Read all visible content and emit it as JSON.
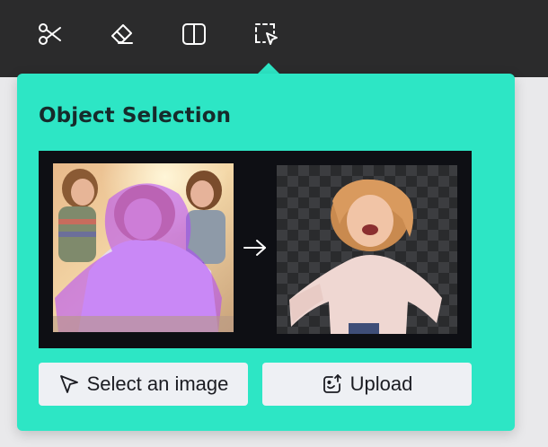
{
  "toolbar": {
    "tools": [
      {
        "icon": "scissors-icon"
      },
      {
        "icon": "eraser-icon"
      },
      {
        "icon": "split-view-icon"
      },
      {
        "icon": "object-select-icon",
        "active": true
      }
    ]
  },
  "popover": {
    "title": "Object Selection",
    "preview": {
      "arrow_icon": "arrow-right-icon"
    },
    "buttons": {
      "select_label": "Select an image",
      "select_icon": "cursor-arrow-icon",
      "upload_label": "Upload",
      "upload_icon": "image-upload-icon"
    }
  },
  "colors": {
    "toolbar_bg": "#2b2b2c",
    "accent": "#2de6c5",
    "button_bg": "#eef0f4",
    "selection_overlay": "#b044ff"
  }
}
